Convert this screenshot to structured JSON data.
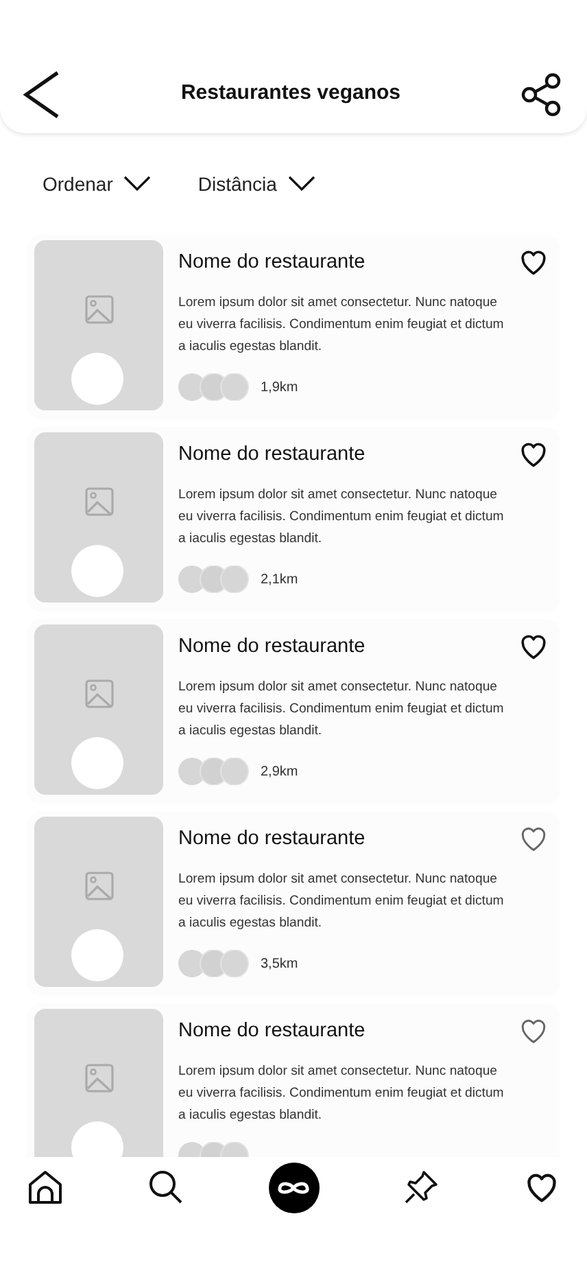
{
  "header": {
    "title": "Restaurantes veganos"
  },
  "filters": [
    {
      "label": "Ordenar"
    },
    {
      "label": "Distância"
    }
  ],
  "restaurants": [
    {
      "name": "Nome do restaurante",
      "description": "Lorem ipsum dolor sit amet consectetur. Nunc natoque eu viverra facilisis. Condimentum enim feugiat et dictum a iaculis egestas blandit.",
      "distance": "1,9km",
      "favorited": true
    },
    {
      "name": "Nome do restaurante",
      "description": "Lorem ipsum dolor sit amet consectetur. Nunc natoque eu viverra facilisis. Condimentum enim feugiat et dictum a iaculis egestas blandit.",
      "distance": "2,1km",
      "favorited": true
    },
    {
      "name": "Nome do restaurante",
      "description": "Lorem ipsum dolor sit amet consectetur. Nunc natoque eu viverra facilisis. Condimentum enim feugiat et dictum a iaculis egestas blandit.",
      "distance": "2,9km",
      "favorited": true
    },
    {
      "name": "Nome do restaurante",
      "description": "Lorem ipsum dolor sit amet consectetur. Nunc natoque eu viverra facilisis. Condimentum enim feugiat et dictum a iaculis egestas blandit.",
      "distance": "3,5km",
      "favorited": false
    },
    {
      "name": "Nome do restaurante",
      "description": "Lorem ipsum dolor sit amet consectetur. Nunc natoque eu viverra facilisis. Condimentum enim feugiat et dictum a iaculis egestas blandit.",
      "favorited": false
    }
  ],
  "bottom_nav": [
    {
      "kind": "home",
      "selected": false
    },
    {
      "kind": "search",
      "selected": false
    },
    {
      "kind": "infinity",
      "selected": true
    },
    {
      "kind": "pin",
      "selected": false
    },
    {
      "kind": "heart",
      "selected": false
    }
  ]
}
